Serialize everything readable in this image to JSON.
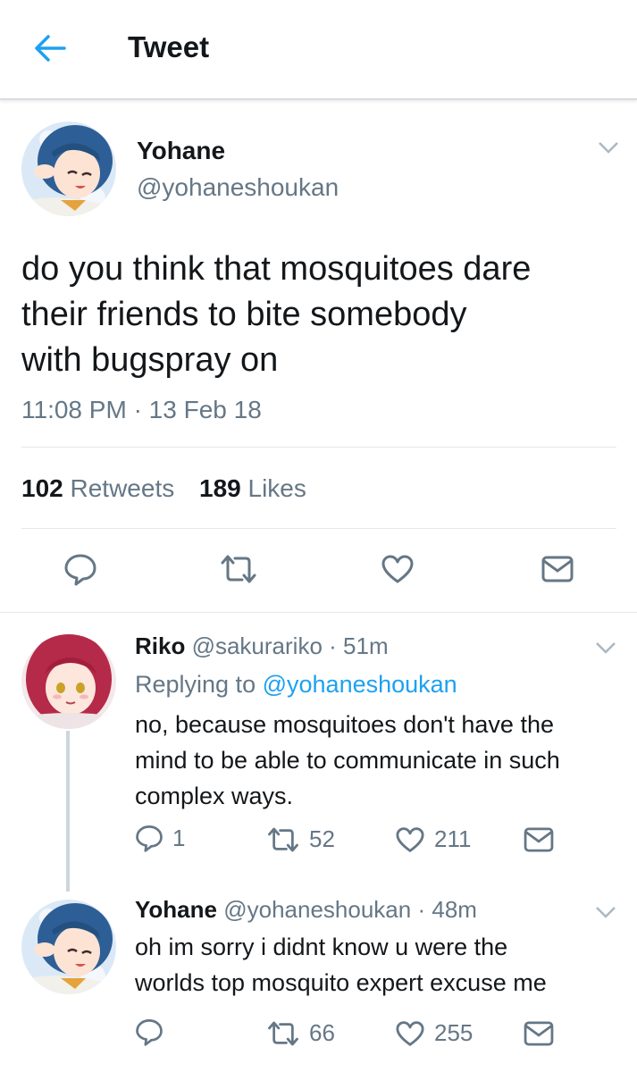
{
  "header": {
    "title": "Tweet",
    "back_icon": "arrow-left-icon",
    "accent": "#1da1f2"
  },
  "main_tweet": {
    "name": "Yohane",
    "handle": "@yohaneshoukan",
    "text_lines": [
      "do you think that mosquitoes dare",
      "their friends to bite somebody",
      "with bugspray on"
    ],
    "time": "11:08 PM",
    "sep": "·",
    "date": "13 Feb 18",
    "retweets_count": "102",
    "retweets_label": "Retweets",
    "likes_count": "189",
    "likes_label": "Likes",
    "actions": [
      "reply-icon",
      "retweet-icon",
      "heart-icon",
      "mail-icon"
    ]
  },
  "replies": [
    {
      "name": "Riko",
      "handle": "@sakurariko",
      "sep": "·",
      "time": "51m",
      "replying_prefix": "Replying to",
      "replying_to": "@yohaneshoukan",
      "text_lines": [
        "no, because mosquitoes don't have the",
        "mind to be able to communicate in such",
        "complex ways."
      ],
      "reply_count": "1",
      "retweet_count": "52",
      "like_count": "211"
    },
    {
      "name": "Yohane",
      "handle": "@yohaneshoukan",
      "sep": "·",
      "time": "48m",
      "text_lines": [
        "oh im sorry i didnt know u were the",
        "worlds top mosquito expert excuse me"
      ],
      "reply_count": "",
      "retweet_count": "66",
      "like_count": "255"
    }
  ],
  "colors": {
    "text": "#14171a",
    "muted": "#657786",
    "link": "#1da1f2",
    "divider": "#e1e8ed",
    "thread_line": "#ccd6dd"
  }
}
